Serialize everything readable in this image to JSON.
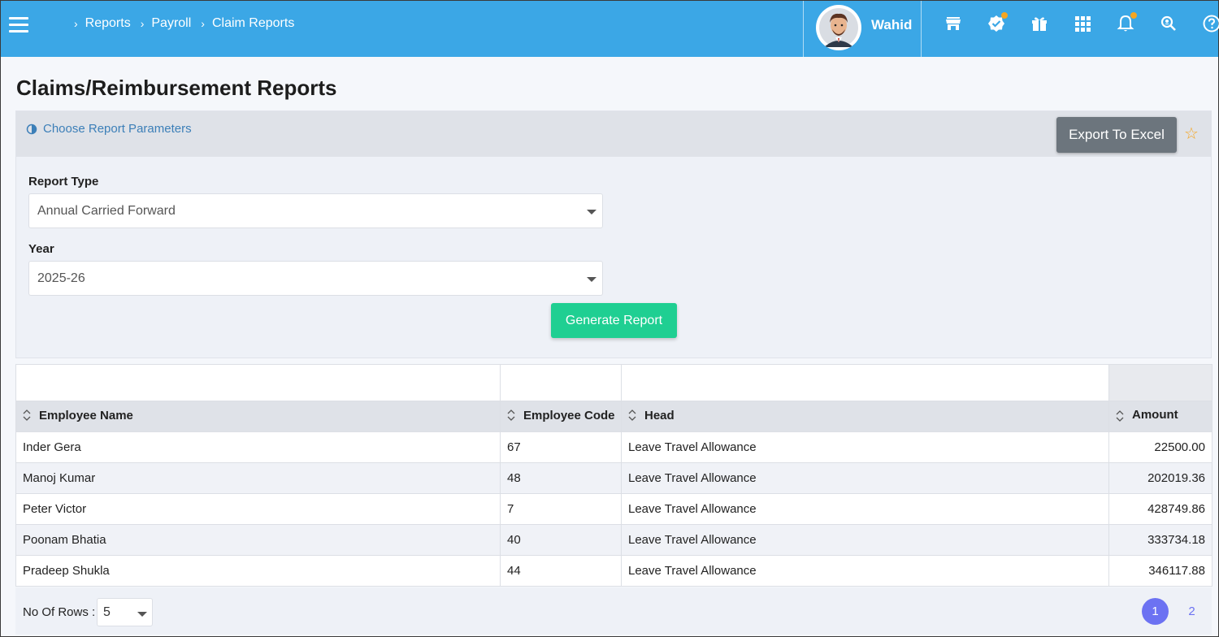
{
  "header": {
    "breadcrumb": [
      "Reports",
      "Payroll",
      "Claim Reports"
    ],
    "user_name": "Wahid",
    "icons": [
      "store-icon",
      "verified-badge-icon",
      "gift-icon",
      "apps-grid-icon",
      "bell-icon",
      "search-person-icon",
      "help-icon"
    ],
    "accent_color": "#3ba7e6"
  },
  "page": {
    "title": "Claims/Reimbursement Reports"
  },
  "params": {
    "choose_label": "Choose Report Parameters",
    "export_label": "Export To Excel",
    "report_type_label": "Report Type",
    "report_type_value": "Annual Carried Forward",
    "year_label": "Year",
    "year_value": "2025-26",
    "generate_label": "Generate Report"
  },
  "table": {
    "columns": [
      "Employee Name",
      "Employee Code",
      "Head",
      "Amount"
    ],
    "rows": [
      {
        "name": "Inder Gera",
        "code": "67",
        "head": "Leave Travel Allowance",
        "amount": "22500.00"
      },
      {
        "name": "Manoj Kumar",
        "code": "48",
        "head": "Leave Travel Allowance",
        "amount": "202019.36"
      },
      {
        "name": "Peter Victor",
        "code": "7",
        "head": "Leave Travel Allowance",
        "amount": "428749.86"
      },
      {
        "name": "Poonam Bhatia",
        "code": "40",
        "head": "Leave Travel Allowance",
        "amount": "333734.18"
      },
      {
        "name": "Pradeep Shukla",
        "code": "44",
        "head": "Leave Travel Allowance",
        "amount": "346117.88"
      }
    ]
  },
  "footer": {
    "rows_label": "No Of Rows :",
    "rows_value": "5",
    "pages": [
      "1",
      "2"
    ],
    "active_page_color": "#6c72f2"
  }
}
